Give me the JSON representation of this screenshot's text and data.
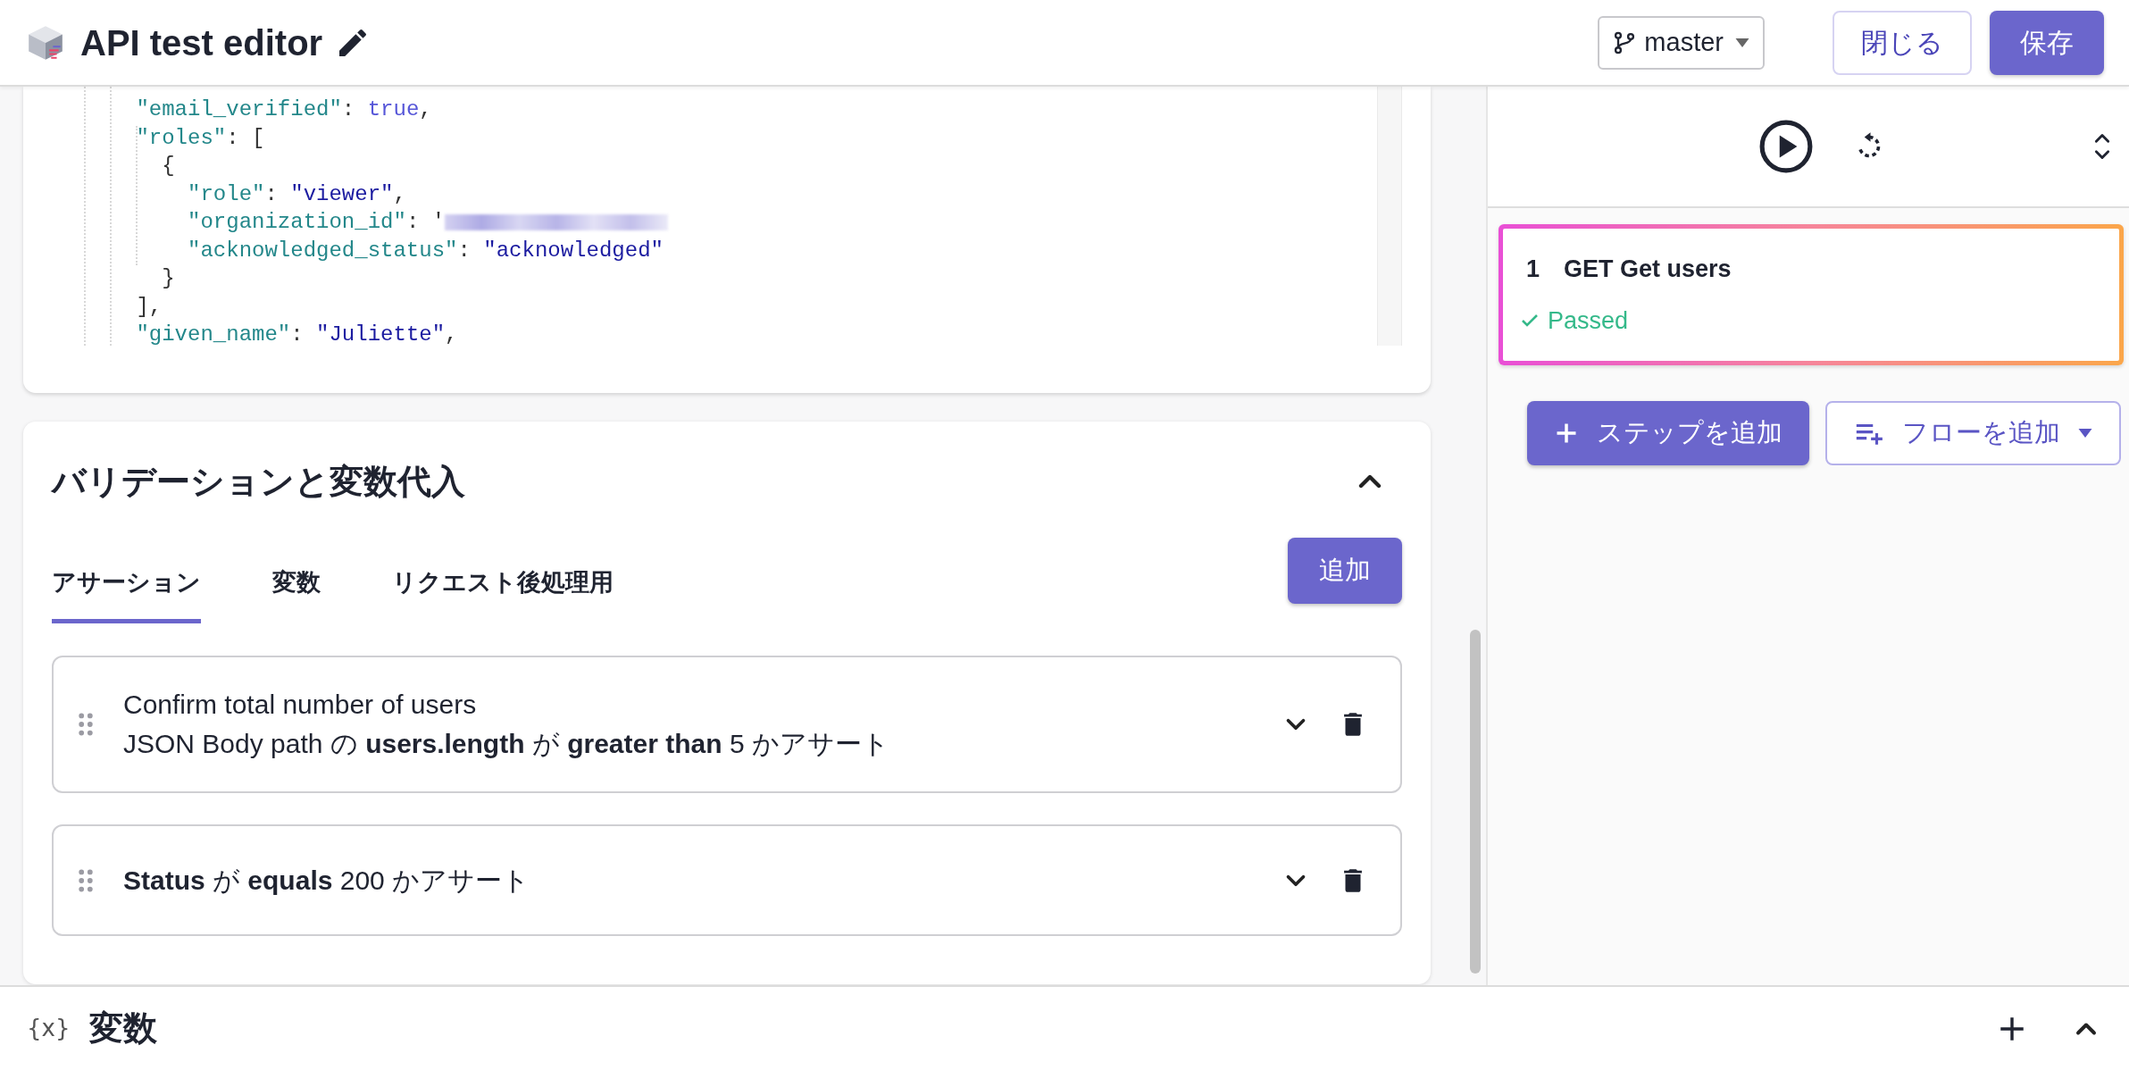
{
  "header": {
    "title": "API test editor",
    "branch": "master",
    "buttons": [
      {
        "label": "閉じる",
        "kind": "outline"
      },
      {
        "label": "保存",
        "kind": "primary"
      }
    ]
  },
  "code": {
    "lines": [
      [
        {
          "kind": "key",
          "text": "      \"email_verified\""
        },
        {
          "kind": "punct",
          "text": ": "
        },
        {
          "kind": "literal",
          "text": "true"
        },
        {
          "kind": "punct",
          "text": ","
        }
      ],
      [
        {
          "kind": "key",
          "text": "      \"roles\""
        },
        {
          "kind": "punct",
          "text": ": ["
        }
      ],
      [
        {
          "kind": "punct",
          "text": "        {"
        }
      ],
      [
        {
          "kind": "key",
          "text": "          \"role\""
        },
        {
          "kind": "punct",
          "text": ": "
        },
        {
          "kind": "string",
          "text": "\"viewer\""
        },
        {
          "kind": "punct",
          "text": ","
        }
      ],
      [
        {
          "kind": "key",
          "text": "          \"organization_id\""
        },
        {
          "kind": "punct",
          "text": ": '"
        },
        {
          "kind": "redacted"
        }
      ],
      [
        {
          "kind": "key",
          "text": "          \"acknowledged_status\""
        },
        {
          "kind": "punct",
          "text": ": "
        },
        {
          "kind": "string",
          "text": "\"acknowledged\""
        }
      ],
      [
        {
          "kind": "punct",
          "text": "        }"
        }
      ],
      [
        {
          "kind": "punct",
          "text": "      ],"
        }
      ],
      [
        {
          "kind": "key",
          "text": "      \"given_name\""
        },
        {
          "kind": "punct",
          "text": ": "
        },
        {
          "kind": "string",
          "text": "\"Juliette\""
        },
        {
          "kind": "punct",
          "text": ","
        }
      ]
    ]
  },
  "validation": {
    "title": "バリデーションと変数代入",
    "expanded": true,
    "add_button": "追加",
    "tabs": [
      {
        "label": "アサーション",
        "selected": true
      },
      {
        "label": "変数",
        "selected": false
      },
      {
        "label": "リクエスト後処理用",
        "selected": false
      }
    ],
    "assertions": [
      {
        "title": "Confirm total number of users",
        "description": "JSON Body path の **users.length** が **greater than** 5 かアサート"
      },
      {
        "description": "**Status** が **equals** 200 かアサート"
      }
    ]
  },
  "steps": [
    {
      "number": "1",
      "name": "GET Get users",
      "status": "Passed",
      "selected": true
    }
  ],
  "step_buttons": [
    {
      "label": "ステップを追加",
      "kind": "primary"
    },
    {
      "label": "フローを追加",
      "kind": "outline"
    }
  ],
  "variables_bar": {
    "icon": "{x}",
    "title": "変数",
    "expanded": false
  }
}
